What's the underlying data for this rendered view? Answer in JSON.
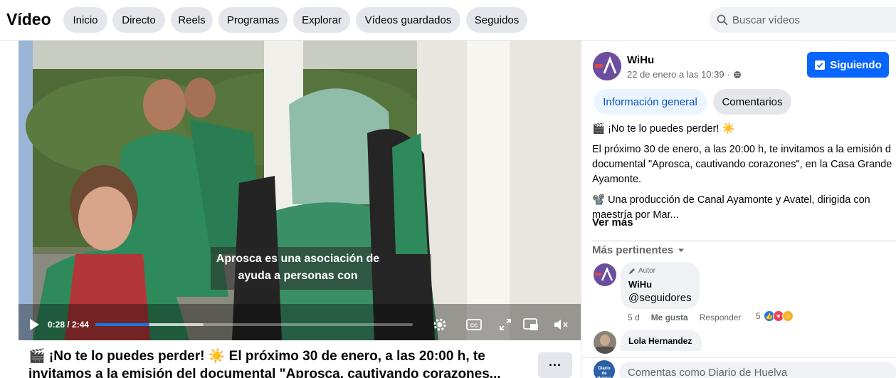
{
  "header": {
    "title": "Vídeo",
    "nav": [
      {
        "label": "Inicio",
        "name": "nav-inicio"
      },
      {
        "label": "Directo",
        "name": "nav-directo"
      },
      {
        "label": "Reels",
        "name": "nav-reels"
      },
      {
        "label": "Programas",
        "name": "nav-programas"
      },
      {
        "label": "Explorar",
        "name": "nav-explorar"
      },
      {
        "label": "Vídeos guardados",
        "name": "nav-videos-guardados"
      },
      {
        "label": "Seguidos",
        "name": "nav-seguidos"
      }
    ],
    "search_placeholder": "Buscar vídeos"
  },
  "player": {
    "subtitle_line1": "Aprosca es una asociación de",
    "subtitle_line2": "ayuda a personas con",
    "time": "0:28 / 2:44",
    "progress_fraction": 0.17,
    "buffer_fraction": 0.34
  },
  "post": {
    "caption_line1": "🎬 ¡No te lo puedes perder! ☀️ El próximo 30 de enero, a las 20:00 h, te",
    "caption_line2": "invitamos a la emisión del documental \"Aprosca, cautivando corazones...",
    "more_label": "···"
  },
  "side": {
    "page_name": "WiHu",
    "date": "22 de enero a las 10:39 ·",
    "follow_label": "Siguiendo",
    "tabs": [
      "Información general",
      "Comentarios"
    ],
    "desc_1": "🎬 ¡No te lo puedes perder! ☀️",
    "desc_2a": "El próximo 30 de enero, a las 20:00 h, te invitamos a la emisión d",
    "desc_2b": "documental \"Aprosca, cautivando corazones\", en la Casa Grande",
    "desc_2c": "Ayamonte.",
    "desc_3a": "📽️ Una producción de Canal Ayamonte y Avatel, dirigida con",
    "desc_3b": "maestría por Mar...",
    "see_more": "Ver más",
    "sort_label": "Más pertinentes",
    "comments": [
      {
        "badge": "Autor",
        "name": "WiHu",
        "text": "@seguidores",
        "age": "5 d",
        "like": "Me gusta",
        "reply": "Responder",
        "reaction_count": "5"
      },
      {
        "name": "Lola Hernandez"
      }
    ],
    "composer_placeholder": "Comentas como Diario de Huelva",
    "composer_avatar_text": "Diario de Huelva"
  },
  "colors": {
    "accent": "#0866ff",
    "progress": "#1b74e4",
    "pill_bg": "#e4e6eb",
    "active_tab_bg": "#ebf5ff"
  }
}
